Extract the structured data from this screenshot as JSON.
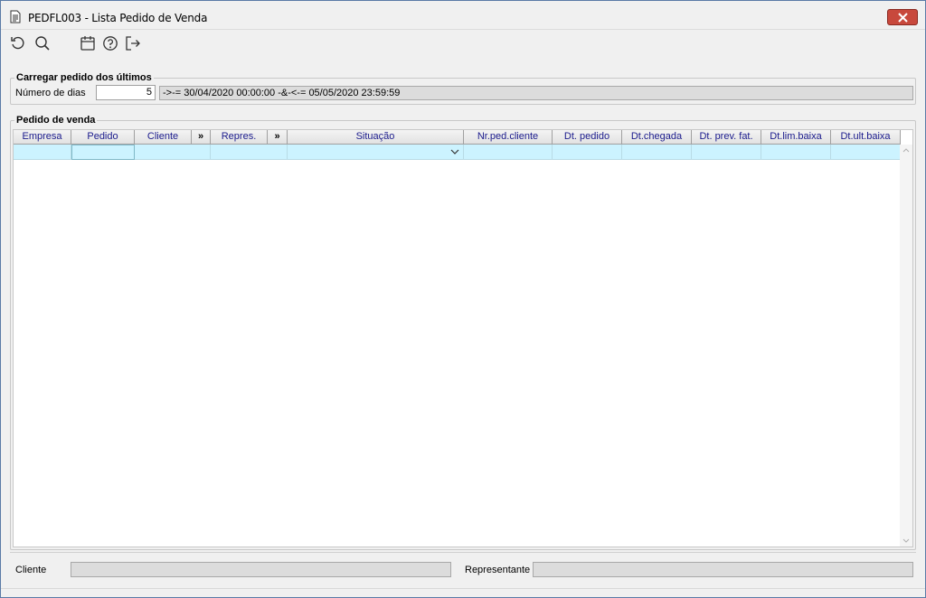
{
  "window": {
    "title": "PEDFL003 - Lista Pedido de Venda"
  },
  "toolbar": {
    "icons": [
      "refresh-icon",
      "search-icon",
      "calendar-icon",
      "help-icon",
      "exit-icon"
    ]
  },
  "load_group": {
    "title": "Carregar pedido dos últimos",
    "days_label": "Número de dias",
    "days_value": "5",
    "range_text": "->-= 30/04/2020 00:00:00 -&-<-= 05/05/2020 23:59:59"
  },
  "orders_group": {
    "title": "Pedido de venda",
    "columns": [
      "Empresa",
      "Pedido",
      "Cliente",
      "»",
      "Repres.",
      "»",
      "Situação",
      "Nr.ped.cliente",
      "Dt. pedido",
      "Dt.chegada",
      "Dt. prev. fat.",
      "Dt.lim.baixa",
      "Dt.ult.baixa"
    ]
  },
  "footer": {
    "client_label": "Cliente",
    "client_value": "",
    "rep_label": "Representante",
    "rep_value": ""
  },
  "colors": {
    "row_highlight": "#ccf3ff",
    "header_text": "#1a1a8c",
    "close_button": "#c8483c"
  }
}
